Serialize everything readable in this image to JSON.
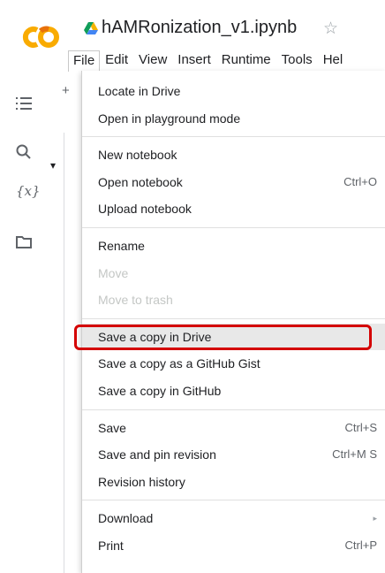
{
  "app": {
    "logo_icon": "colab-logo-icon",
    "drive_icon": "google-drive-icon",
    "notebook_title": "hAMRonization_v1.ipynb",
    "star_icon": "star-outline-icon",
    "accent_orange": "#f9ab00",
    "accent_red": "#d40000"
  },
  "menubar": [
    "File",
    "Edit",
    "View",
    "Insert",
    "Runtime",
    "Tools",
    "Hel"
  ],
  "sidebar": {
    "icons": [
      "table-of-contents-icon",
      "search-icon",
      "variables-icon",
      "folder-icon"
    ],
    "variables_label": "{x}"
  },
  "background": {
    "add_label": "+",
    "caret": "▾"
  },
  "file_menu": {
    "groups": [
      {
        "items": [
          {
            "label": "Locate in Drive",
            "shortcut": ""
          },
          {
            "label": "Open in playground mode",
            "shortcut": ""
          }
        ]
      },
      {
        "items": [
          {
            "label": "New notebook",
            "shortcut": ""
          },
          {
            "label": "Open notebook",
            "shortcut": "Ctrl+O"
          },
          {
            "label": "Upload notebook",
            "shortcut": ""
          }
        ]
      },
      {
        "items": [
          {
            "label": "Rename",
            "shortcut": ""
          },
          {
            "label": "Move",
            "shortcut": "",
            "disabled": true
          },
          {
            "label": "Move to trash",
            "shortcut": "",
            "disabled": true
          }
        ]
      },
      {
        "items": [
          {
            "label": "Save a copy in Drive",
            "shortcut": "",
            "highlighted": true
          },
          {
            "label": "Save a copy as a GitHub Gist",
            "shortcut": ""
          },
          {
            "label": "Save a copy in GitHub",
            "shortcut": ""
          }
        ]
      },
      {
        "items": [
          {
            "label": "Save",
            "shortcut": "Ctrl+S"
          },
          {
            "label": "Save and pin revision",
            "shortcut": "Ctrl+M S"
          },
          {
            "label": "Revision history",
            "shortcut": ""
          }
        ]
      },
      {
        "items": [
          {
            "label": "Download",
            "shortcut": "",
            "submenu_arrow": "▸"
          },
          {
            "label": "Print",
            "shortcut": "Ctrl+P"
          }
        ]
      }
    ]
  }
}
